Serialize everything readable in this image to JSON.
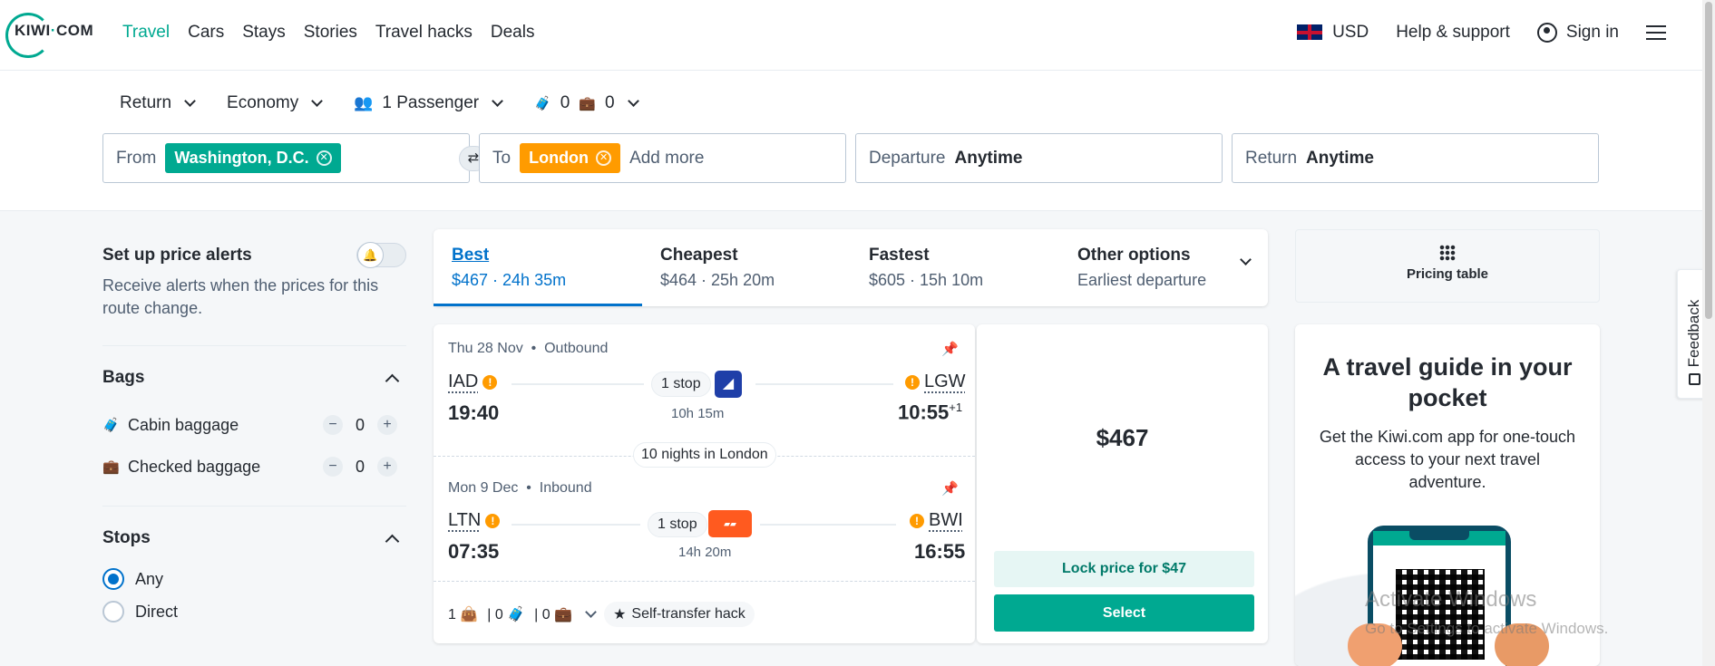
{
  "header": {
    "logo": {
      "left": "KIWI",
      "dot": "·",
      "right": "COM"
    },
    "nav": [
      "Travel",
      "Cars",
      "Stays",
      "Stories",
      "Travel hacks",
      "Deals"
    ],
    "currency": "USD",
    "help": "Help & support",
    "sign_in": "Sign in"
  },
  "search": {
    "trip_type": "Return",
    "cabin": "Economy",
    "passengers": "1 Passenger",
    "cabin_bags": "0",
    "checked_bags": "0",
    "from_label": "From",
    "from_value": "Washington, D.C.",
    "to_label": "To",
    "to_value": "London",
    "add_more": "Add more",
    "departure_label": "Departure",
    "departure_value": "Anytime",
    "return_label": "Return",
    "return_value": "Anytime",
    "swap_icon": "⇄"
  },
  "sidebar": {
    "alerts_title": "Set up price alerts",
    "alerts_desc": "Receive alerts when the prices for this route change.",
    "bags_title": "Bags",
    "cabin_label": "Cabin baggage",
    "cabin_count": "0",
    "checked_label": "Checked baggage",
    "checked_count": "0",
    "stops_title": "Stops",
    "stops_options": [
      "Any",
      "Direct"
    ]
  },
  "sort_tabs": [
    {
      "title": "Best",
      "sub": "$467 · 24h 35m"
    },
    {
      "title": "Cheapest",
      "sub": "$464 · 25h 20m"
    },
    {
      "title": "Fastest",
      "sub": "$605 · 15h 10m"
    },
    {
      "title": "Other options",
      "sub": "Earliest departure"
    }
  ],
  "result": {
    "outbound": {
      "date": "Thu 28 Nov",
      "dir": "Outbound",
      "from": "IAD",
      "dep": "19:40",
      "stops": "1 stop",
      "duration": "10h 15m",
      "to": "LGW",
      "arr": "10:55",
      "day_offset": "+1"
    },
    "nights": "10 nights in London",
    "inbound": {
      "date": "Mon 9 Dec",
      "dir": "Inbound",
      "from": "LTN",
      "dep": "07:35",
      "stops": "1 stop",
      "duration": "14h 20m",
      "to": "BWI",
      "arr": "16:55"
    },
    "bags": {
      "personal": "1",
      "cabin": "0",
      "checked": "0"
    },
    "hack": "Self-transfer hack",
    "price": "$467",
    "lock": "Lock price for $47",
    "select": "Select"
  },
  "right": {
    "pricing_table": "Pricing table",
    "promo_title": "A travel guide in your pocket",
    "promo_text": "Get the Kiwi.com app for one-touch access to your next travel adventure.",
    "feedback": "Feedback"
  },
  "watermark": {
    "line1": "Activate Windows",
    "line2": "Go to Settings to activate Windows."
  },
  "colors": {
    "brand": "#00a991",
    "accent_blue": "#0172cb",
    "orange": "#ff9b00"
  }
}
